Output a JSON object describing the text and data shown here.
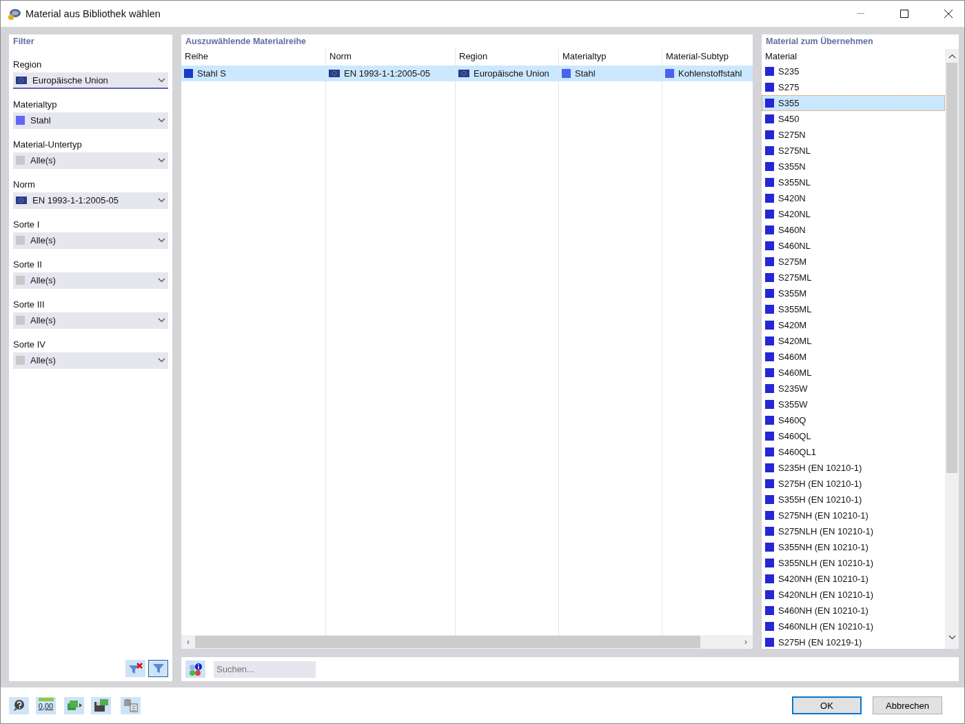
{
  "window": {
    "title": "Material aus Bibliothek wählen"
  },
  "filter": {
    "title": "Filter",
    "fields": [
      {
        "label": "Region",
        "value": "Europäische Union",
        "kind": "flag",
        "focused": true
      },
      {
        "label": "Materialtyp",
        "value": "Stahl",
        "kind": "swatch",
        "color": "#6464ff",
        "focused": false
      },
      {
        "label": "Material-Untertyp",
        "value": "Alle(s)",
        "kind": "swatch",
        "color": "#c8c8c8",
        "focused": false
      },
      {
        "label": "Norm",
        "value": "EN 1993-1-1:2005-05",
        "kind": "flag",
        "focused": false
      },
      {
        "label": "Sorte I",
        "value": "Alle(s)",
        "kind": "swatch",
        "color": "#c8c8c8",
        "focused": false
      },
      {
        "label": "Sorte II",
        "value": "Alle(s)",
        "kind": "swatch",
        "color": "#c8c8c8",
        "focused": false
      },
      {
        "label": "Sorte III",
        "value": "Alle(s)",
        "kind": "swatch",
        "color": "#c8c8c8",
        "focused": false
      },
      {
        "label": "Sorte IV",
        "value": "Alle(s)",
        "kind": "swatch",
        "color": "#c8c8c8",
        "focused": false
      }
    ]
  },
  "series_table": {
    "title": "Auszuwählende Materialreihe",
    "columns": [
      "Reihe",
      "Norm",
      "Region",
      "Materialtyp",
      "Material-Subtyp"
    ],
    "rows": [
      {
        "selected": true,
        "cells": [
          {
            "text": "Stahl S",
            "kind": "swatch",
            "color": "#1a3acc"
          },
          {
            "text": "EN 1993-1-1:2005-05",
            "kind": "flag"
          },
          {
            "text": "Europäische Union",
            "kind": "flag"
          },
          {
            "text": "Stahl",
            "kind": "swatch",
            "color": "#4a62f0"
          },
          {
            "text": "Kohlenstoffstahl",
            "kind": "swatch",
            "color": "#4a62f0"
          }
        ]
      }
    ]
  },
  "scroll_arrows": {
    "left": "‹",
    "right": "›"
  },
  "search": {
    "placeholder": "Suchen..."
  },
  "materials": {
    "title": "Material zum Übernehmen",
    "column": "Material",
    "items": [
      {
        "name": "S235",
        "selected": false
      },
      {
        "name": "S275",
        "selected": false
      },
      {
        "name": "S355",
        "selected": true
      },
      {
        "name": "S450",
        "selected": false
      },
      {
        "name": "S275N",
        "selected": false
      },
      {
        "name": "S275NL",
        "selected": false
      },
      {
        "name": "S355N",
        "selected": false
      },
      {
        "name": "S355NL",
        "selected": false
      },
      {
        "name": "S420N",
        "selected": false
      },
      {
        "name": "S420NL",
        "selected": false
      },
      {
        "name": "S460N",
        "selected": false
      },
      {
        "name": "S460NL",
        "selected": false
      },
      {
        "name": "S275M",
        "selected": false
      },
      {
        "name": "S275ML",
        "selected": false
      },
      {
        "name": "S355M",
        "selected": false
      },
      {
        "name": "S355ML",
        "selected": false
      },
      {
        "name": "S420M",
        "selected": false
      },
      {
        "name": "S420ML",
        "selected": false
      },
      {
        "name": "S460M",
        "selected": false
      },
      {
        "name": "S460ML",
        "selected": false
      },
      {
        "name": "S235W",
        "selected": false
      },
      {
        "name": "S355W",
        "selected": false
      },
      {
        "name": "S460Q",
        "selected": false
      },
      {
        "name": "S460QL",
        "selected": false
      },
      {
        "name": "S460QL1",
        "selected": false
      },
      {
        "name": "S235H (EN 10210-1)",
        "selected": false
      },
      {
        "name": "S275H (EN 10210-1)",
        "selected": false
      },
      {
        "name": "S355H (EN 10210-1)",
        "selected": false
      },
      {
        "name": "S275NH (EN 10210-1)",
        "selected": false
      },
      {
        "name": "S275NLH (EN 10210-1)",
        "selected": false
      },
      {
        "name": "S355NH (EN 10210-1)",
        "selected": false
      },
      {
        "name": "S355NLH (EN 10210-1)",
        "selected": false
      },
      {
        "name": "S420NH (EN 10210-1)",
        "selected": false
      },
      {
        "name": "S420NLH (EN 10210-1)",
        "selected": false
      },
      {
        "name": "S460NH (EN 10210-1)",
        "selected": false
      },
      {
        "name": "S460NLH (EN 10210-1)",
        "selected": false
      },
      {
        "name": "S275H (EN 10219-1)",
        "selected": false
      }
    ]
  },
  "footer": {
    "units_icon_text": "0,00",
    "buttons": [
      {
        "label": "OK",
        "default": true
      },
      {
        "label": "Abbrechen",
        "default": false
      }
    ]
  }
}
